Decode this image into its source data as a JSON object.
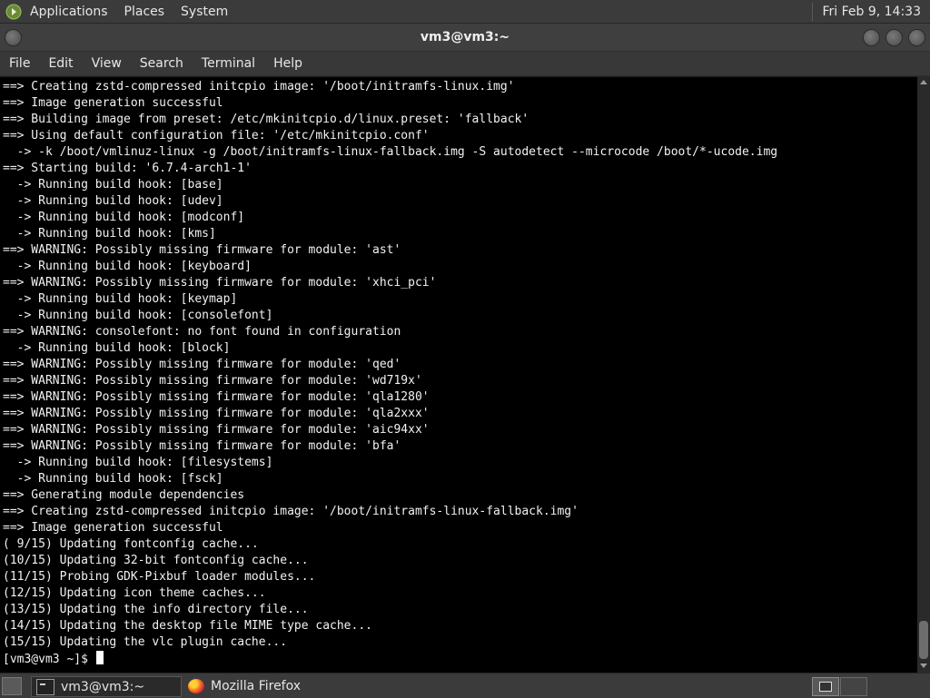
{
  "top_panel": {
    "menus": [
      "Applications",
      "Places",
      "System"
    ],
    "clock": "Fri Feb  9, 14:33"
  },
  "window": {
    "title": "vm3@vm3:~"
  },
  "menubar": {
    "items": [
      "File",
      "Edit",
      "View",
      "Search",
      "Terminal",
      "Help"
    ]
  },
  "terminal": {
    "lines": [
      "==> Creating zstd-compressed initcpio image: '/boot/initramfs-linux.img'",
      "==> Image generation successful",
      "==> Building image from preset: /etc/mkinitcpio.d/linux.preset: 'fallback'",
      "==> Using default configuration file: '/etc/mkinitcpio.conf'",
      "  -> -k /boot/vmlinuz-linux -g /boot/initramfs-linux-fallback.img -S autodetect --microcode /boot/*-ucode.img",
      "==> Starting build: '6.7.4-arch1-1'",
      "  -> Running build hook: [base]",
      "  -> Running build hook: [udev]",
      "  -> Running build hook: [modconf]",
      "  -> Running build hook: [kms]",
      "==> WARNING: Possibly missing firmware for module: 'ast'",
      "  -> Running build hook: [keyboard]",
      "==> WARNING: Possibly missing firmware for module: 'xhci_pci'",
      "  -> Running build hook: [keymap]",
      "  -> Running build hook: [consolefont]",
      "==> WARNING: consolefont: no font found in configuration",
      "  -> Running build hook: [block]",
      "==> WARNING: Possibly missing firmware for module: 'qed'",
      "==> WARNING: Possibly missing firmware for module: 'wd719x'",
      "==> WARNING: Possibly missing firmware for module: 'qla1280'",
      "==> WARNING: Possibly missing firmware for module: 'qla2xxx'",
      "==> WARNING: Possibly missing firmware for module: 'aic94xx'",
      "==> WARNING: Possibly missing firmware for module: 'bfa'",
      "  -> Running build hook: [filesystems]",
      "  -> Running build hook: [fsck]",
      "==> Generating module dependencies",
      "==> Creating zstd-compressed initcpio image: '/boot/initramfs-linux-fallback.img'",
      "==> Image generation successful",
      "( 9/15) Updating fontconfig cache...",
      "(10/15) Updating 32-bit fontconfig cache...",
      "(11/15) Probing GDK-Pixbuf loader modules...",
      "(12/15) Updating icon theme caches...",
      "(13/15) Updating the info directory file...",
      "(14/15) Updating the desktop file MIME type cache...",
      "(15/15) Updating the vlc plugin cache..."
    ],
    "prompt": "[vm3@vm3 ~]$ "
  },
  "taskbar": {
    "tasks": [
      {
        "label": "vm3@vm3:~",
        "icon": "terminal-icon",
        "active": true
      },
      {
        "label": "Mozilla Firefox",
        "icon": "firefox-icon",
        "active": false
      }
    ]
  }
}
